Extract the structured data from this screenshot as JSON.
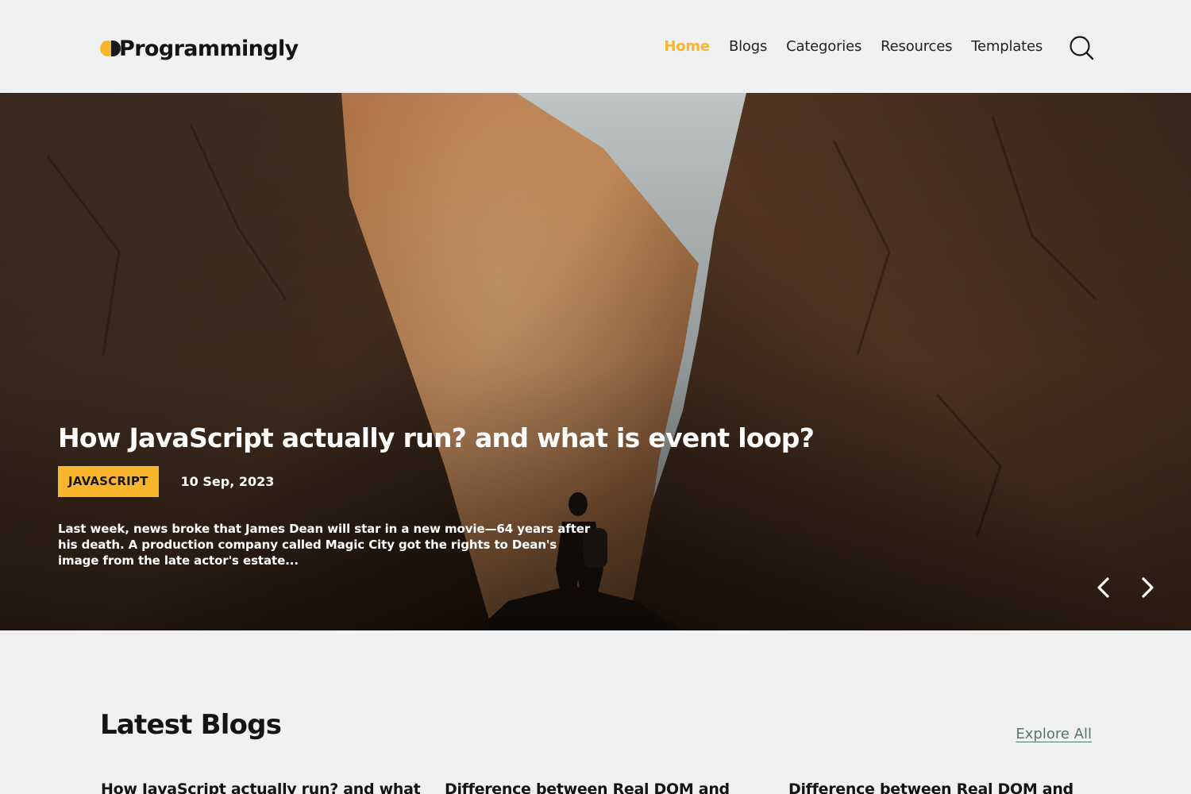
{
  "brand": {
    "name": "Programmingly",
    "accent_color": "#f9b52c"
  },
  "nav": {
    "items": [
      {
        "label": "Home",
        "active": true
      },
      {
        "label": "Blogs",
        "active": false
      },
      {
        "label": "Categories",
        "active": false
      },
      {
        "label": "Resources",
        "active": false
      },
      {
        "label": "Templates",
        "active": false
      }
    ],
    "search_icon": "search-icon"
  },
  "hero": {
    "title": "How JavaScript actually run? and what is event loop?",
    "tag": "JAVASCRIPT",
    "date": "10 Sep, 2023",
    "excerpt": "Last week, news broke that James Dean will star in a new movie—64 years after his death. A production company called Magic City got the rights to Dean's image from the late actor's estate...",
    "prev_icon": "chevron-left-icon",
    "next_icon": "chevron-right-icon"
  },
  "latest": {
    "title": "Latest Blogs",
    "explore_label": "Explore All",
    "cards": [
      {
        "title": "How JavaScript actually run? and what"
      },
      {
        "title": "Difference between Real DOM and"
      },
      {
        "title": "Difference between Real DOM and"
      }
    ]
  }
}
